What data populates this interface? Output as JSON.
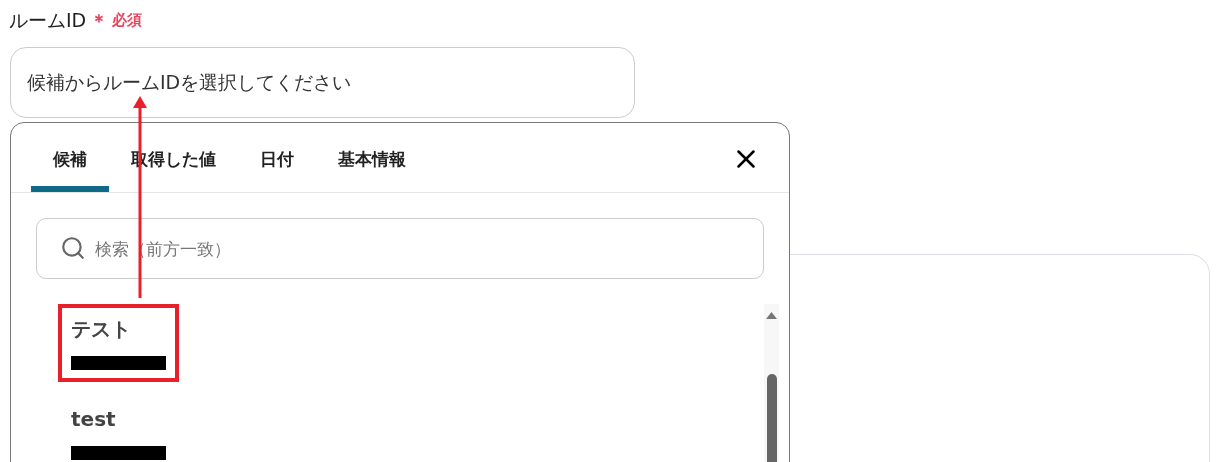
{
  "field": {
    "label": "ルームID",
    "required_mark": "＊",
    "required_text": "必須",
    "placeholder": "候補からルームIDを選択してください"
  },
  "dropdown": {
    "tabs": [
      {
        "label": "候補",
        "selected": true
      },
      {
        "label": "取得した値",
        "selected": false
      },
      {
        "label": "日付",
        "selected": false
      },
      {
        "label": "基本情報",
        "selected": false
      }
    ],
    "search": {
      "placeholder": "検索（前方一致）"
    },
    "options": [
      {
        "label": "テスト",
        "highlighted": true
      },
      {
        "label": "test",
        "highlighted": false
      }
    ]
  }
}
